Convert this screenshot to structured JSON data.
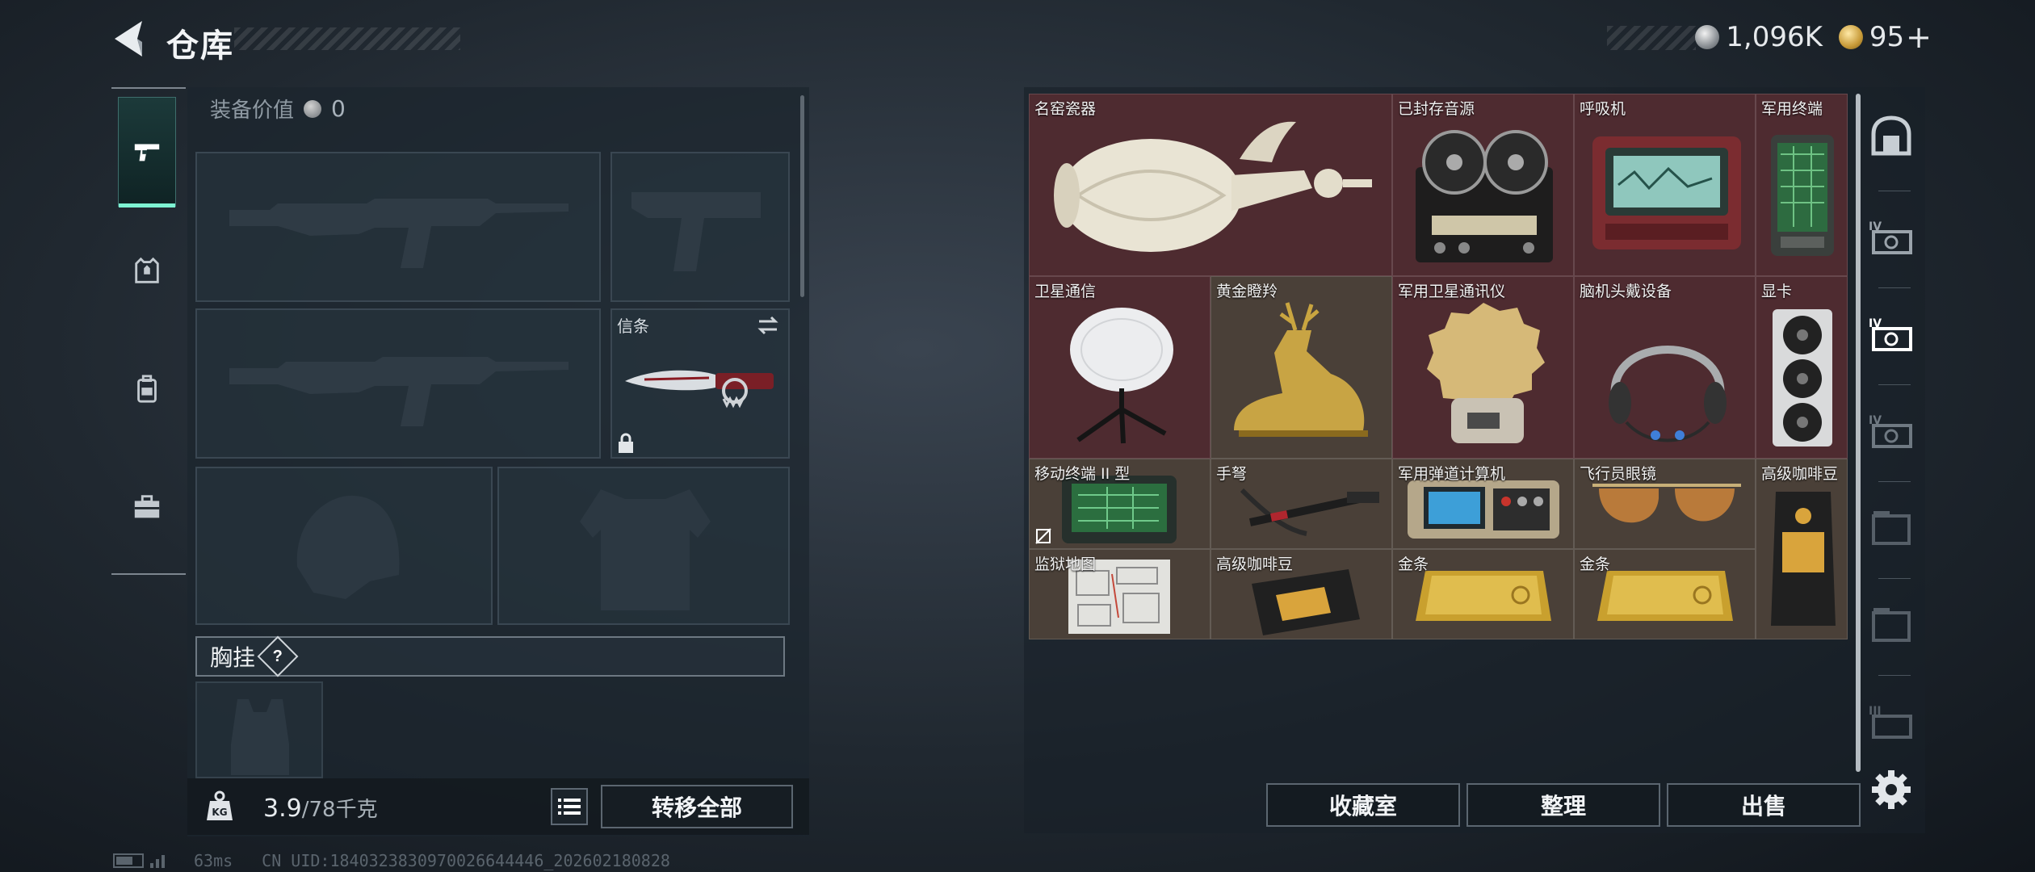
{
  "header": {
    "title": "仓库",
    "currency_silver": "1,096K",
    "currency_gold": "95",
    "add_label": "+"
  },
  "left_tabs": [
    {
      "name": "weapon",
      "icon": "pistol-icon",
      "active": true
    },
    {
      "name": "armor",
      "icon": "vest-icon",
      "active": false
    },
    {
      "name": "backpack",
      "icon": "backpack-icon",
      "active": false
    },
    {
      "name": "case",
      "icon": "briefcase-icon",
      "active": false
    }
  ],
  "loadout": {
    "gear_value_label": "装备价值",
    "gear_value": "0",
    "slots": {
      "primary_1": {
        "icon": "rifle-silhouette-icon"
      },
      "sidearm": {
        "icon": "pistol-silhouette-icon"
      },
      "primary_2": {
        "icon": "rifle-silhouette-icon"
      },
      "melee": {
        "label": "信条",
        "icon": "knife-icon",
        "locked": true
      },
      "helmet": {
        "icon": "helmet-silhouette-icon"
      },
      "body_armor": {
        "icon": "armor-silhouette-icon"
      }
    },
    "chest_rig_label": "胸挂",
    "help_label": "?",
    "weight_current": "3.9",
    "weight_max": "/78千克",
    "transfer_all_label": "转移全部"
  },
  "storage": {
    "items": [
      {
        "name": "名窑瓷器",
        "icon": "vase-icon"
      },
      {
        "name": "已封存音源",
        "icon": "reel-recorder-icon"
      },
      {
        "name": "呼吸机",
        "icon": "ventilator-icon"
      },
      {
        "name": "军用终端",
        "icon": "terminal-icon"
      },
      {
        "name": "卫星通信",
        "icon": "satellite-dish-icon"
      },
      {
        "name": "黄金瞪羚",
        "icon": "gold-gazelle-icon"
      },
      {
        "name": "军用卫星通讯仪",
        "icon": "sat-comm-icon"
      },
      {
        "name": "脑机头戴设备",
        "icon": "headset-icon"
      },
      {
        "name": "显卡",
        "icon": "gpu-icon"
      },
      {
        "name": "移动终端 II 型",
        "icon": "mobile-terminal-icon"
      },
      {
        "name": "手弩",
        "icon": "crossbow-icon"
      },
      {
        "name": "军用弹道计算机",
        "icon": "ballistic-computer-icon"
      },
      {
        "name": "飞行员眼镜",
        "icon": "aviator-glasses-icon"
      },
      {
        "name": "高级咖啡豆",
        "icon": "coffee-bag-icon"
      },
      {
        "name": "监狱地图",
        "icon": "map-icon"
      },
      {
        "name": "高级咖啡豆",
        "icon": "coffee-bag-icon"
      },
      {
        "name": "金条",
        "icon": "gold-bar-icon"
      },
      {
        "name": "金条",
        "icon": "gold-bar-icon"
      }
    ],
    "actions": {
      "collection": "收藏室",
      "sort": "整理",
      "sell": "出售"
    }
  },
  "right_tabs": [
    {
      "icon": "vault-icon",
      "level": ""
    },
    {
      "icon": "storage-tier-iv-icon",
      "level": "IV"
    },
    {
      "icon": "storage-tier-iv-icon",
      "level": "IV"
    },
    {
      "icon": "storage-tier-iv-icon",
      "level": "IV"
    },
    {
      "icon": "storage-tier-icon",
      "level": ""
    },
    {
      "icon": "storage-tier-icon",
      "level": ""
    },
    {
      "icon": "storage-tier-iii-icon",
      "level": "III"
    }
  ],
  "status": {
    "ping": "63ms",
    "uid": "CN UID:1840323830970026644446_202602180828"
  },
  "colors": {
    "accent": "#7ef2d2",
    "grid_bg": "#4e2b30",
    "panel_bg": "#1c262e"
  }
}
